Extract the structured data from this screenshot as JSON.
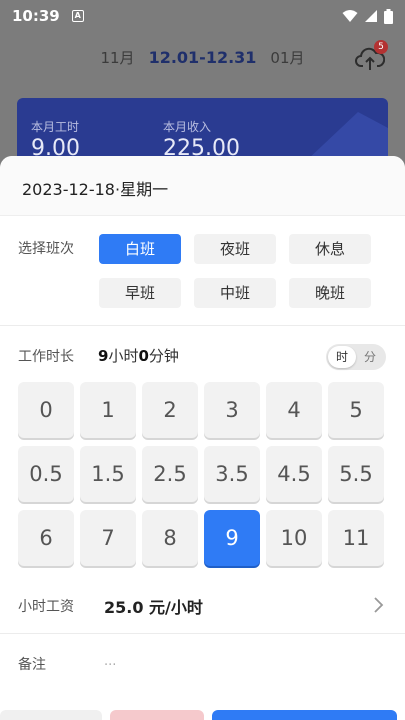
{
  "status_bar": {
    "time": "10:39",
    "notice_letter": "A"
  },
  "month_nav": {
    "prev": "11月",
    "current": "12.01-12.31",
    "next": "01月"
  },
  "upload": {
    "badge": "5"
  },
  "summary": {
    "hours_label": "本月工时",
    "hours_value": "9.00",
    "income_label": "本月收入",
    "income_value": "225.00"
  },
  "sheet": {
    "date": "2023-12-18·星期一",
    "shift": {
      "label": "选择班次",
      "options": [
        "白班",
        "夜班",
        "休息",
        "早班",
        "中班",
        "晚班"
      ],
      "selected": "白班"
    },
    "duration": {
      "label": "工作时长",
      "hours": "9",
      "hours_unit": "小时",
      "minutes": "0",
      "minutes_unit": "分钟",
      "unit_hour": "时",
      "unit_minute": "分"
    },
    "keypad": [
      "0",
      "1",
      "2",
      "3",
      "4",
      "5",
      "0.5",
      "1.5",
      "2.5",
      "3.5",
      "4.5",
      "5.5",
      "6",
      "7",
      "8",
      "9",
      "10",
      "11"
    ],
    "keypad_selected": "9",
    "wage": {
      "label": "小时工资",
      "value": "25.0 元/小时"
    },
    "remark": {
      "label": "备注",
      "placeholder": "..."
    }
  },
  "colors": {
    "accent": "#2f7bf5",
    "card": "#2a3b91",
    "overlay": "#7c7c7c"
  }
}
